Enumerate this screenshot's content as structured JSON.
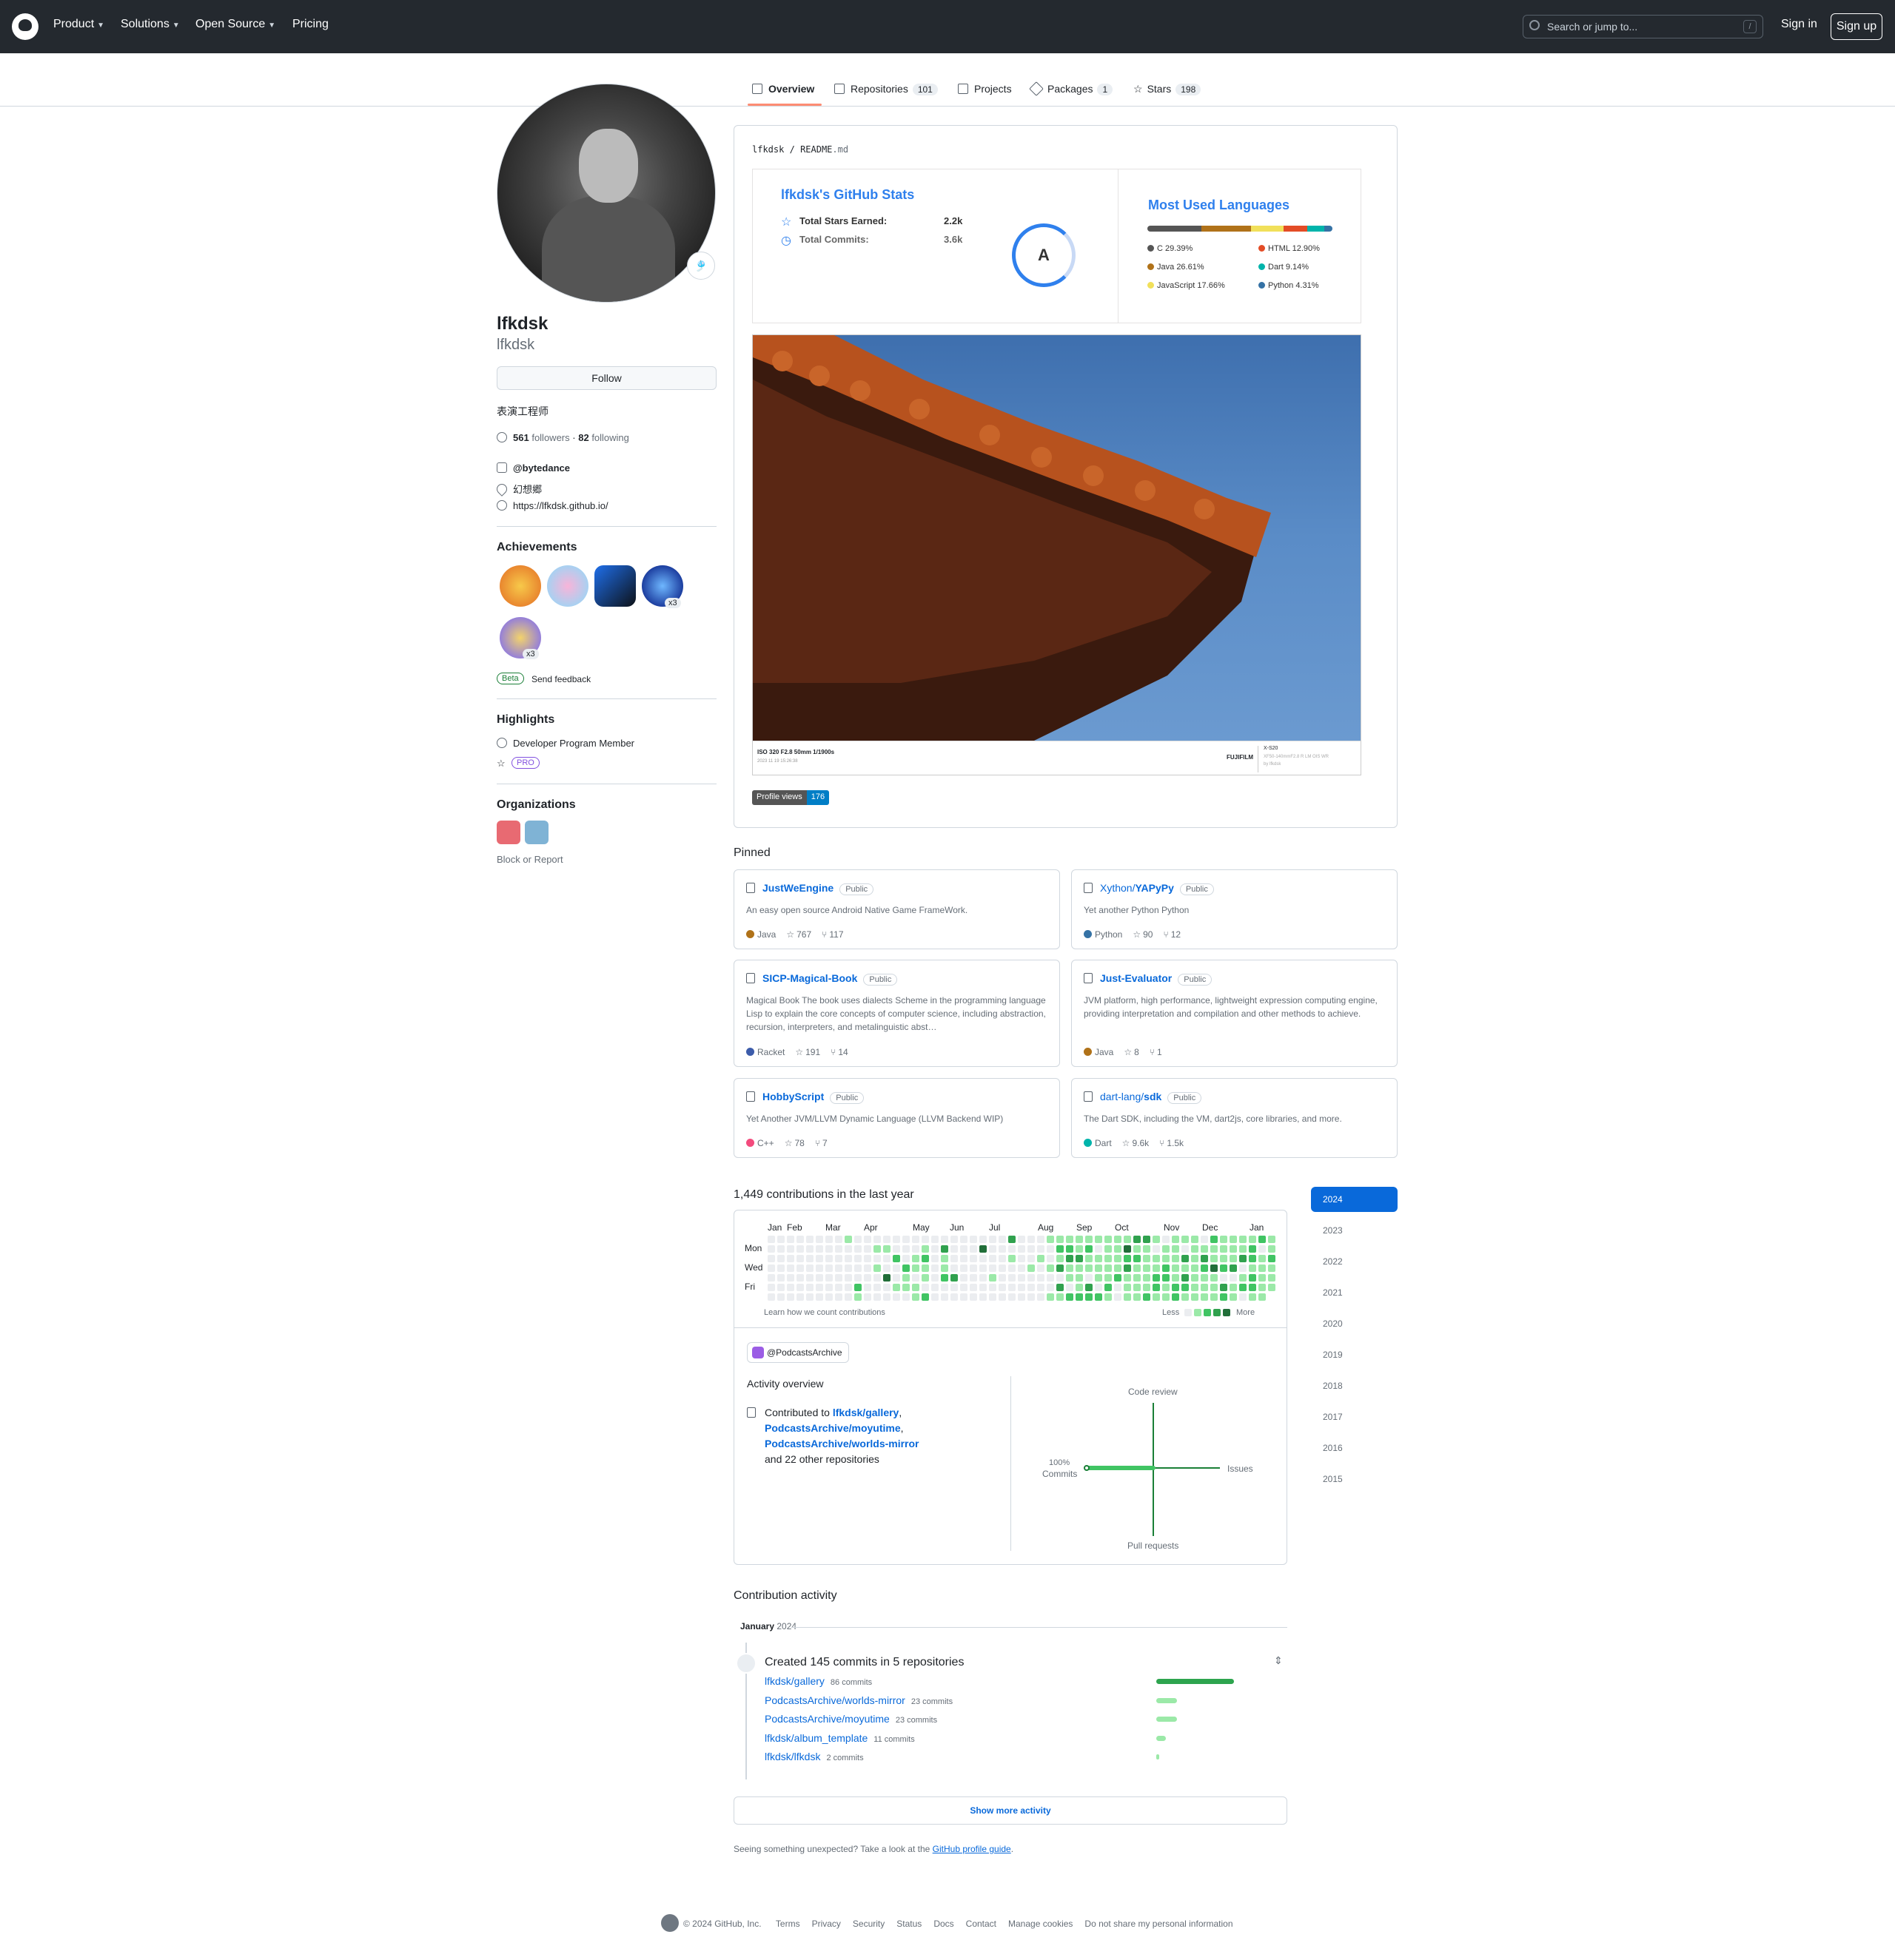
{
  "header": {
    "nav": [
      "Product",
      "Solutions",
      "Open Source",
      "Pricing"
    ],
    "search_placeholder": "Search or jump to...",
    "search_key": "/",
    "sign_in": "Sign in",
    "sign_up": "Sign up"
  },
  "tabs": [
    {
      "label": "Overview",
      "count": ""
    },
    {
      "label": "Repositories",
      "count": "101"
    },
    {
      "label": "Projects",
      "count": ""
    },
    {
      "label": "Packages",
      "count": "1"
    },
    {
      "label": "Stars",
      "count": "198"
    }
  ],
  "profile": {
    "name": "lfkdsk",
    "username": "lfkdsk",
    "follow_label": "Follow",
    "bio": "表演工程师",
    "followers": "561",
    "followers_label": "followers",
    "following": "82",
    "following_label": "following",
    "sep": "·",
    "company": "@bytedance",
    "location": "幻想郷",
    "website": "https://lfkdsk.github.io/"
  },
  "achievements": {
    "title": "Achievements",
    "badges": [
      {
        "name": "starstruck",
        "count": ""
      },
      {
        "name": "yolo",
        "count": ""
      },
      {
        "name": "arctic-code-vault",
        "count": ""
      },
      {
        "name": "pull-shark",
        "count": "x3"
      },
      {
        "name": "quickdraw",
        "count": "x3"
      }
    ],
    "beta": "Beta",
    "feedback": "Send feedback"
  },
  "highlights": {
    "title": "Highlights",
    "developer": "Developer Program Member",
    "pro": "PRO"
  },
  "organizations": {
    "title": "Organizations",
    "block": "Block or Report"
  },
  "readme": {
    "path_user": "lfkdsk",
    "path_sep": "/",
    "path_file": "README",
    "path_ext": ".md",
    "stats_title": "lfkdsk's GitHub Stats",
    "stars_label": "Total Stars Earned:",
    "stars_value": "2.2k",
    "commits_label": "Total Commits:",
    "commits_value": "3.6k",
    "grade": "A",
    "langs_title": "Most Used Languages",
    "languages": [
      {
        "name": "C",
        "pct": "29.39%",
        "value": 29.39,
        "color": "#555555"
      },
      {
        "name": "HTML",
        "pct": "12.90%",
        "value": 12.9,
        "color": "#e34c26"
      },
      {
        "name": "Java",
        "pct": "26.61%",
        "value": 26.61,
        "color": "#b07219"
      },
      {
        "name": "Dart",
        "pct": "9.14%",
        "value": 9.14,
        "color": "#00b4ab"
      },
      {
        "name": "JavaScript",
        "pct": "17.66%",
        "value": 17.66,
        "color": "#f1e05a"
      },
      {
        "name": "Python",
        "pct": "4.31%",
        "value": 4.31,
        "color": "#3572a5"
      }
    ],
    "photo_exif": "ISO 320 F2.8 50mm 1/1900s",
    "photo_date": "2023 11 19 15:26:38",
    "photo_brand": "FUJIFILM",
    "photo_model": "X-S20",
    "photo_lens": "XF50-140mmF2.8 R LM OIS WR",
    "photo_by": "by lfkdsk",
    "views_label": "Profile views",
    "views_value": "176"
  },
  "pinned": {
    "title": "Pinned",
    "public": "Public",
    "items": [
      {
        "owner": "",
        "repo": "JustWeEngine",
        "desc": "An easy open source Android Native Game FrameWork.",
        "lang": "Java",
        "color": "#b07219",
        "stars": "767",
        "forks": "117"
      },
      {
        "owner": "Xython/",
        "repo": "YAPyPy",
        "desc": "Yet another Python Python",
        "lang": "Python",
        "color": "#3572a5",
        "stars": "90",
        "forks": "12"
      },
      {
        "owner": "",
        "repo": "SICP-Magical-Book",
        "desc": "Magical Book The book uses dialects Scheme in the programming language Lisp to explain the core concepts of computer science, including abstraction, recursion, interpreters, and metalinguistic abst…",
        "lang": "Racket",
        "color": "#3c5caa",
        "stars": "191",
        "forks": "14"
      },
      {
        "owner": "",
        "repo": "Just-Evaluator",
        "desc": "JVM platform, high performance, lightweight expression computing engine, providing interpretation and compilation and other methods to achieve.",
        "lang": "Java",
        "color": "#b07219",
        "stars": "8",
        "forks": "1"
      },
      {
        "owner": "",
        "repo": "HobbyScript",
        "desc": "Yet Another JVM/LLVM Dynamic Language (LLVM Backend WIP)",
        "lang": "C++",
        "color": "#f34b7d",
        "stars": "78",
        "forks": "7"
      },
      {
        "owner": "dart-lang/",
        "repo": "sdk",
        "desc": "The Dart SDK, including the VM, dart2js, core libraries, and more.",
        "lang": "Dart",
        "color": "#00b4ab",
        "stars": "9.6k",
        "forks": "1.5k"
      }
    ]
  },
  "contributions": {
    "title": "1,449 contributions in the last year",
    "months": [
      "Jan",
      "Feb",
      "Mar",
      "Apr",
      "May",
      "Jun",
      "Jul",
      "Aug",
      "Sep",
      "Oct",
      "Nov",
      "Dec",
      "Jan"
    ],
    "days": [
      "Mon",
      "Wed",
      "Fri"
    ],
    "learn": "Learn how we count contributions",
    "less": "Less",
    "more": "More",
    "years": [
      "2024",
      "2023",
      "2022",
      "2021",
      "2020",
      "2019",
      "2018",
      "2017",
      "2016",
      "2015"
    ],
    "org": "@PodcastsArchive",
    "overview_title": "Activity overview",
    "contributed_to": "Contributed to",
    "repos": [
      "lfkdsk/gallery",
      "PodcastsArchive/moyutime",
      "PodcastsArchive/worlds-mirror"
    ],
    "and_other": "and 22 other repositories",
    "axis_code_review": "Code review",
    "axis_issues": "Issues",
    "axis_pull_requests": "Pull requests",
    "axis_commits": "Commits",
    "commits_pct": "100%",
    "commits_share": 1.0
  },
  "activity": {
    "title": "Contribution activity",
    "month": "January",
    "year": "2024",
    "summary": "Created 145 commits in 5 repositories",
    "rows": [
      {
        "repo": "lfkdsk/gallery",
        "commits": "86 commits",
        "value": 86
      },
      {
        "repo": "PodcastsArchive/worlds-mirror",
        "commits": "23 commits",
        "value": 23
      },
      {
        "repo": "PodcastsArchive/moyutime",
        "commits": "23 commits",
        "value": 23
      },
      {
        "repo": "lfkdsk/album_template",
        "commits": "11 commits",
        "value": 11
      },
      {
        "repo": "lfkdsk/lfkdsk",
        "commits": "2 commits",
        "value": 2
      }
    ],
    "show_more": "Show more activity",
    "unexpected": "Seeing something unexpected? Take a look at the",
    "guide": "GitHub profile guide",
    "period": "."
  },
  "footer": {
    "copyright": "© 2024 GitHub, Inc.",
    "links": [
      "Terms",
      "Privacy",
      "Security",
      "Status",
      "Docs",
      "Contact",
      "Manage cookies",
      "Do not share my personal information"
    ]
  },
  "colors": {
    "accent": "#0969da",
    "header_bg": "#24292f",
    "tab_underline": "#fd8c73"
  }
}
